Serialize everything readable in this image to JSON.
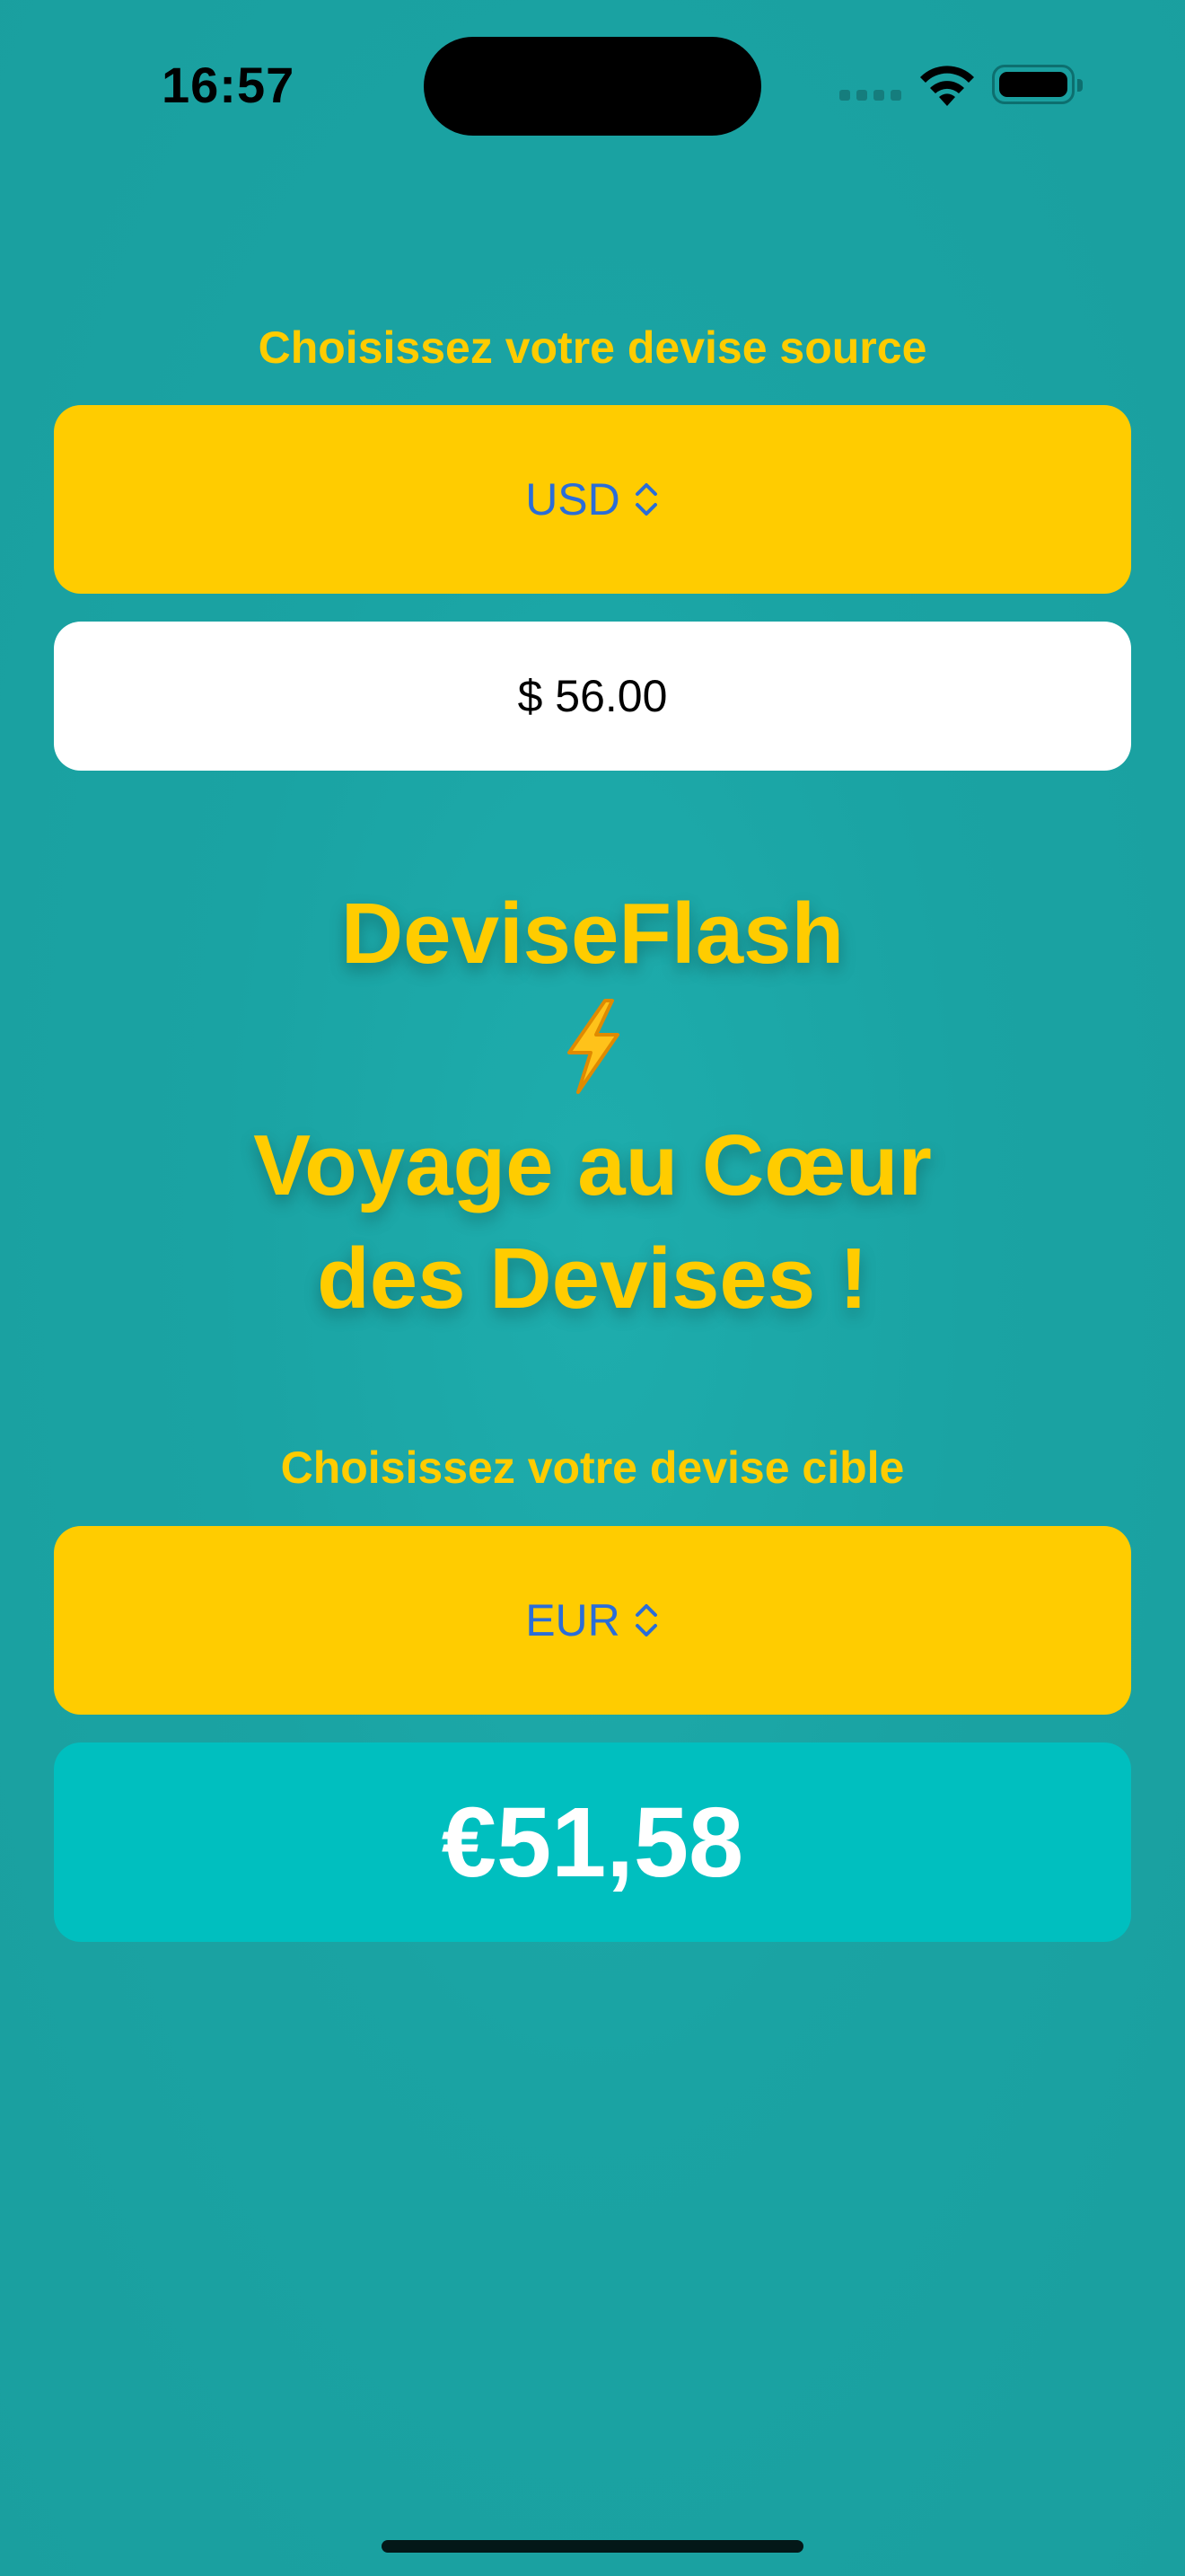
{
  "status_bar": {
    "time": "16:57",
    "signal_icon": "cellular-signal-icon",
    "wifi_icon": "wifi-icon",
    "battery_icon": "battery-icon"
  },
  "source": {
    "label": "Choisissez votre devise source",
    "currency": "USD",
    "amount": "$ 56.00"
  },
  "headline": {
    "app_name": "DeviseFlash",
    "icon": "lightning-bolt-icon",
    "tagline_line1": "Voyage au Cœur",
    "tagline_line2": "des Devises !"
  },
  "target": {
    "label": "Choisissez votre devise cible",
    "currency": "EUR",
    "result": "€51,58"
  },
  "colors": {
    "background": "#1aa3a3",
    "accent_yellow": "#ffcc00",
    "picker_text": "#2a6dd8",
    "result_bg": "#00bfbf"
  }
}
